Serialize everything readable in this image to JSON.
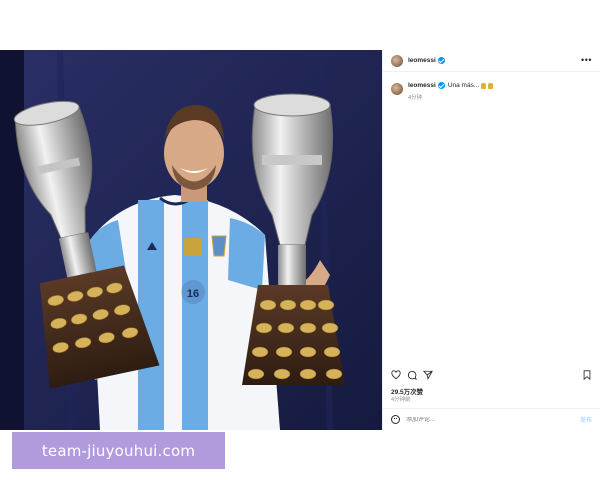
{
  "post": {
    "username": "leomessi",
    "more_icon": "more-horizontal-icon",
    "caption": {
      "username": "leomessi",
      "text": "Una más...",
      "emojis": [
        "trophy-icon",
        "trophy-icon"
      ],
      "time": "4分钟"
    },
    "actions": {
      "like_icon": "heart-icon",
      "comment_icon": "comment-icon",
      "share_icon": "send-icon",
      "save_icon": "bookmark-icon"
    },
    "likes": "29.5万次赞",
    "time": "4分钟前",
    "comment": {
      "placeholder": "添加评论...",
      "post_label": "发布"
    }
  },
  "photo": {
    "jersey_number": "16"
  },
  "watermark": {
    "text": "team-jiuyouhui.com"
  },
  "colors": {
    "verified": "#0095f6",
    "background_blue": "#1a1f4a",
    "jersey_blue": "#6cace4",
    "watermark_bg": "#b19bdc"
  }
}
